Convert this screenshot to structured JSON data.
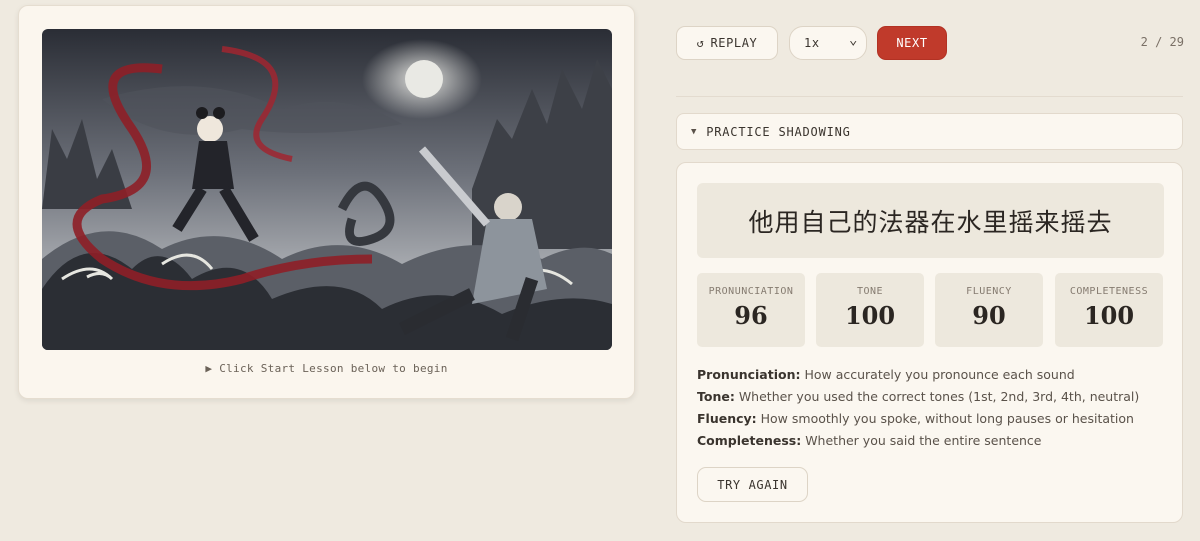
{
  "lesson_card": {
    "hint": "▶ Click Start Lesson below to begin"
  },
  "controls": {
    "replay_icon": "↺",
    "replay_label": "REPLAY",
    "speed_value": "1x",
    "speed_caret": "⌄",
    "next_label": "NEXT",
    "counter": "2 / 29"
  },
  "practice": {
    "toggle_icon": "▼",
    "label": "PRACTICE SHADOWING"
  },
  "results": {
    "sentence": "他用自己的法器在水里摇来摇去",
    "scores": [
      {
        "label": "PRONUNCIATION",
        "value": "96"
      },
      {
        "label": "TONE",
        "value": "100"
      },
      {
        "label": "FLUENCY",
        "value": "90"
      },
      {
        "label": "COMPLETENESS",
        "value": "100"
      }
    ],
    "descriptions": [
      {
        "term": "Pronunciation:",
        "text": " How accurately you pronounce each sound"
      },
      {
        "term": "Tone:",
        "text": " Whether you used the correct tones (1st, 2nd, 3rd, 4th, neutral)"
      },
      {
        "term": "Fluency:",
        "text": " How smoothly you spoke, without long pauses or hesitation"
      },
      {
        "term": "Completeness:",
        "text": " Whether you said the entire sentence"
      }
    ],
    "try_again_label": "TRY AGAIN"
  },
  "colors": {
    "background": "#efeae0",
    "accent_red": "#c03a2b",
    "card": "#fbf7f0",
    "score_tile": "#ede8dd"
  }
}
